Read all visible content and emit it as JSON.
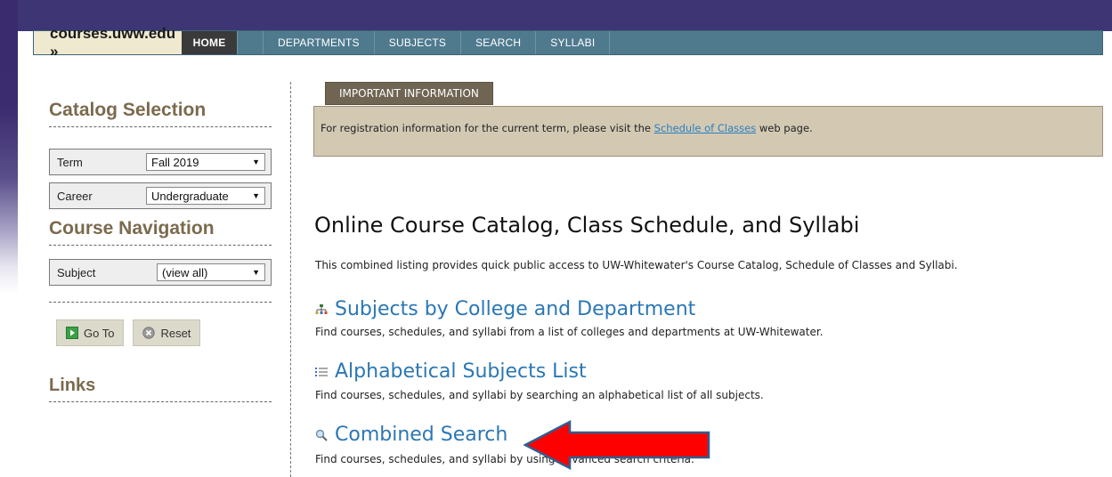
{
  "nav": {
    "site": "courses.uww.edu »",
    "items": [
      "HOME",
      "DEPARTMENTS",
      "SUBJECTS",
      "SEARCH",
      "SYLLABI"
    ]
  },
  "sidebar": {
    "catalog_heading": "Catalog Selection",
    "term_label": "Term",
    "term_value": "Fall 2019",
    "career_label": "Career",
    "career_value": "Undergraduate",
    "nav_heading": "Course Navigation",
    "subject_label": "Subject",
    "subject_value": "(view all)",
    "goto_label": "Go To",
    "reset_label": "Reset",
    "links_heading": "Links"
  },
  "info": {
    "tab": "IMPORTANT INFORMATION",
    "text_before": "For registration information for the current term, please visit the ",
    "link": "Schedule of Classes",
    "text_after": " web page."
  },
  "main": {
    "title": "Online Course Catalog, Class Schedule, and Syllabi",
    "intro": "This combined listing provides quick public access to UW-Whitewater's Course Catalog, Schedule of Classes and Syllabi.",
    "links": [
      {
        "title": "Subjects by College and Department",
        "desc": "Find courses, schedules, and syllabi from a list of colleges and departments at UW-Whitewater."
      },
      {
        "title": "Alphabetical Subjects List",
        "desc": "Find courses, schedules, and syllabi by searching an alphabetical list of all subjects."
      },
      {
        "title": "Combined Search",
        "desc": "Find courses, schedules, and syllabi by using advanced search criteria."
      }
    ]
  },
  "colors": {
    "accent_arrow": "#ff0000",
    "nav_bar": "#4f7a8e",
    "link_blue": "#2b77b4"
  }
}
